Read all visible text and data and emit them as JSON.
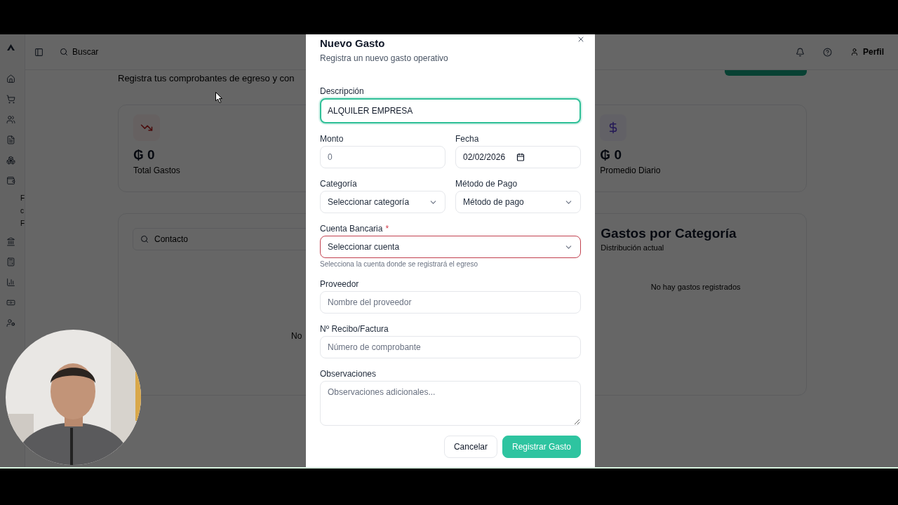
{
  "sidebar": {
    "fragments": [
      "F",
      "c",
      "F"
    ]
  },
  "topbar": {
    "search_placeholder": "Buscar",
    "profile": "Perfil"
  },
  "page": {
    "subtitle": "Registra tus comprobantes de egreso y con",
    "stats": [
      {
        "kind": "down",
        "value": "₲ 0",
        "label": "Total Gastos"
      },
      {
        "kind": "dollar",
        "value": "₲ 0",
        "label": "Promedio Diario"
      }
    ],
    "contact_search": {
      "placeholder": "Contacto"
    },
    "list_fragment": "No",
    "category_panel": {
      "title": "Gastos por Categoría",
      "subtitle": "Distribución actual",
      "empty": "No hay gastos registrados"
    }
  },
  "dialog": {
    "title": "Nuevo Gasto",
    "subtitle": "Registra un nuevo gasto operativo",
    "rows": [
      {
        "fields": [
          {
            "label": "Descripción",
            "kind": "text",
            "value": "ALQUILER EMPRESA",
            "focused": true,
            "required": false
          }
        ]
      },
      {
        "fields": [
          {
            "label": "Monto",
            "kind": "text",
            "placeholder": "0",
            "focused": false,
            "required": false
          },
          {
            "label": "Fecha",
            "kind": "date",
            "value": "02/02/2026",
            "focused": false,
            "required": false
          }
        ]
      },
      {
        "fields": [
          {
            "label": "Categoría",
            "kind": "select",
            "value": "Seleccionar categoría",
            "focused": false,
            "required": false
          },
          {
            "label": "Método de Pago",
            "kind": "select",
            "value": "Método de pago",
            "focused": false,
            "required": false
          }
        ]
      },
      {
        "fields": [
          {
            "label": "Cuenta Bancaria",
            "kind": "select",
            "value": "Seleccionar cuenta",
            "focused": false,
            "required": true,
            "required_mark": "*",
            "hint": "Selecciona la cuenta donde se registrará el egreso"
          }
        ]
      },
      {
        "fields": [
          {
            "label": "Proveedor",
            "kind": "text",
            "placeholder": "Nombre del proveedor",
            "focused": false,
            "required": false
          }
        ]
      },
      {
        "fields": [
          {
            "label": "Nº Recibo/Factura",
            "kind": "text",
            "placeholder": "Número de comprobante",
            "focused": false,
            "required": false
          }
        ]
      },
      {
        "fields": [
          {
            "label": "Observaciones",
            "kind": "textarea",
            "placeholder": "Observaciones adicionales...",
            "focused": false,
            "required": false
          }
        ]
      }
    ],
    "buttons": [
      {
        "label": "Cancelar",
        "kind": "secondary"
      },
      {
        "label": "Registrar Gasto",
        "kind": "primary"
      }
    ]
  }
}
